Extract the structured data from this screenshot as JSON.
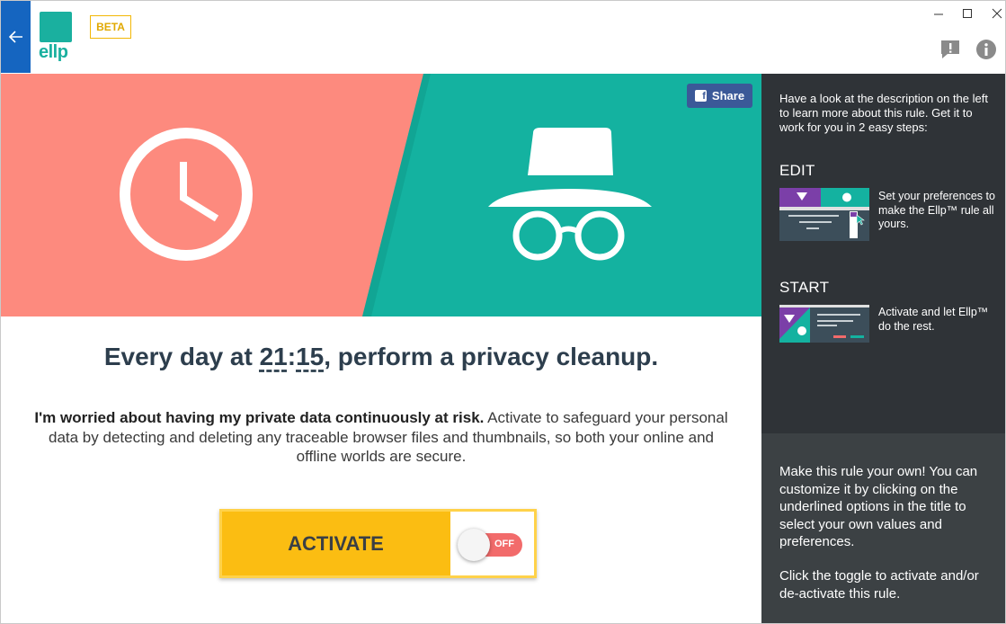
{
  "header": {
    "logo_text": "ellp",
    "beta_label": "BETA",
    "colors": {
      "back_strip": "#1565c0",
      "brand": "#1ab09f",
      "beta": "#f2b705"
    },
    "icons": [
      "back-arrow-icon",
      "minimize-icon",
      "maximize-icon",
      "close-icon",
      "feedback-icon",
      "info-icon"
    ]
  },
  "hero": {
    "share_label": "Share",
    "colors": {
      "left": "#fd8a7e",
      "right": "#14b2a0",
      "share": "#3b5998"
    },
    "icons": [
      "clock-icon",
      "incognito-icon"
    ]
  },
  "rule": {
    "title_prefix": "Every day at ",
    "hour": "21",
    "separator": ":",
    "minute": "15",
    "title_suffix": ", perform a privacy cleanup.",
    "desc_bold": "I'm worried about having my private data continuously at risk.",
    "desc_rest": " Activate to safeguard your personal data by detecting and deleting any traceable browser files and thumbnails, so both your online and offline worlds are secure."
  },
  "activate": {
    "label": "ACTIVATE",
    "toggle_state": "OFF",
    "colors": {
      "button": "#fbbd12",
      "toggle_off": "#f26b6b"
    }
  },
  "sidebar": {
    "intro": "Have a look at the description on the left to learn more about this rule. Get it to work for you in 2 easy steps:",
    "steps": [
      {
        "heading": "EDIT",
        "text": "Set your preferences to make the Ellp™ rule all yours."
      },
      {
        "heading": "START",
        "text": "Activate and let Ellp™ do the rest."
      }
    ],
    "tip1": "Make this rule your own! You can customize it by clicking on the underlined options in the title to select your own values and preferences.",
    "tip2": "Click the toggle to activate and/or de-activate this rule.",
    "colors": {
      "top": "#2f3337",
      "bottom": "#3c4144"
    }
  }
}
